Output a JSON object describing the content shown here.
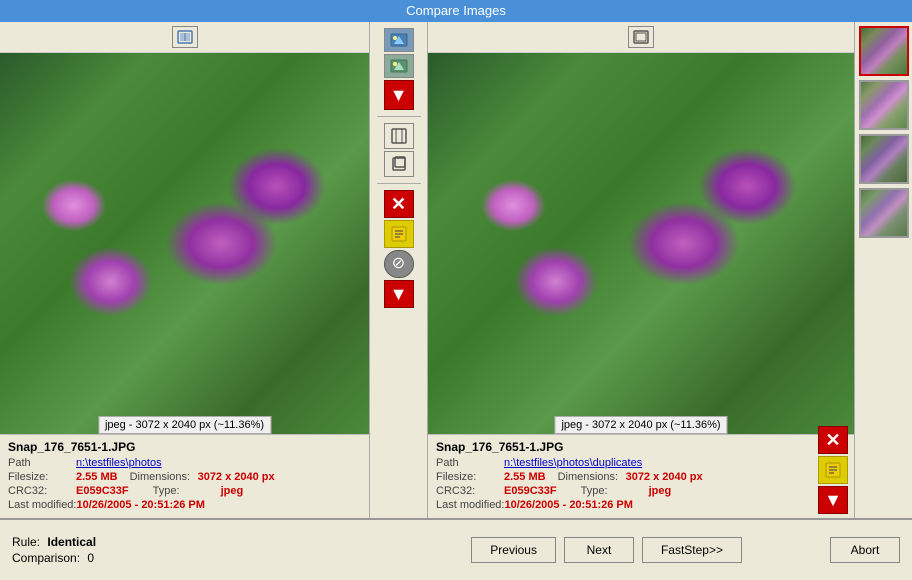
{
  "window": {
    "title": "Compare Images"
  },
  "left_image": {
    "filename": "Snap_176_7651-1.JPG",
    "path_label": "Path",
    "path_value": "n:\\testfiles\\photos",
    "filesize_label": "Filesize:",
    "filesize_value": "2.55 MB",
    "dimensions_label": "Dimensions:",
    "dimensions_value": "3072 x 2040 px",
    "crc32_label": "CRC32:",
    "crc32_value": "E059C33F",
    "type_label": "Type:",
    "type_value": "jpeg",
    "lastmod_label": "Last modified:",
    "lastmod_value": "10/26/2005 - 20:51:26 PM",
    "image_info": "jpeg - 3072 x 2040 px (~11.36%)"
  },
  "right_image": {
    "filename": "Snap_176_7651-1.JPG",
    "path_label": "Path",
    "path_value": "n:\\testfiles\\photos\\duplicates",
    "filesize_label": "Filesize:",
    "filesize_value": "2.55 MB",
    "dimensions_label": "Dimensions:",
    "dimensions_value": "3072 x 2040 px",
    "crc32_label": "CRC32:",
    "crc32_value": "E059C33F",
    "type_label": "Type:",
    "type_value": "jpeg",
    "lastmod_label": "Last modified:",
    "lastmod_value": "10/26/2005 - 20:51:26 PM",
    "image_info": "jpeg - 3072 x 2040 px (~11.36%)"
  },
  "footer": {
    "rule_label": "Rule:",
    "rule_value": "Identical",
    "comparison_label": "Comparison:",
    "comparison_value": "0",
    "btn_previous": "Previous",
    "btn_next": "Next",
    "btn_faststep": "FastStep>>",
    "btn_abort": "Abort"
  }
}
